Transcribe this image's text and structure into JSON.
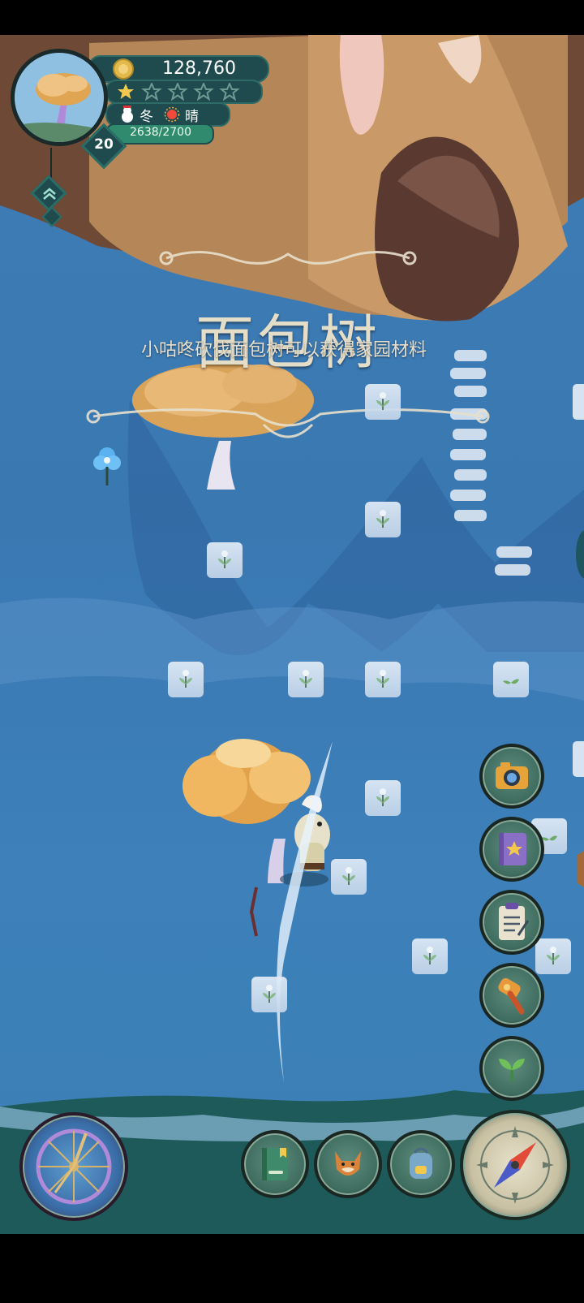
{
  "hud": {
    "coins": "128,760",
    "stars_filled": 1,
    "stars_total": 5,
    "season": "冬",
    "weather": "晴",
    "xp": "2638/2700",
    "level": "20",
    "season_icon": "snowman-icon",
    "weather_icon": "sun-icon",
    "coin_icon": "coin-icon"
  },
  "banner": {
    "title": "面包树",
    "subtitle": "小咕咚砍伐面包树可以获得家园材料"
  },
  "side_buttons": [
    {
      "name": "camera-button",
      "icon": "camera-icon"
    },
    {
      "name": "achievement-book-button",
      "icon": "star-book-icon"
    },
    {
      "name": "tasks-button",
      "icon": "clipboard-icon"
    },
    {
      "name": "hammer-button",
      "icon": "hammer-icon"
    },
    {
      "name": "planting-button",
      "icon": "sprout-icon"
    }
  ],
  "bottom_buttons": [
    {
      "name": "handbook-button",
      "icon": "book-icon"
    },
    {
      "name": "pet-button",
      "icon": "fox-icon"
    },
    {
      "name": "backpack-button",
      "icon": "backpack-icon"
    }
  ],
  "colors": {
    "water": "#3b7ab4",
    "hud_dark": "#1f4b4f",
    "xp_green": "#2f8a6e",
    "banner_text": "#e4ddc8"
  }
}
